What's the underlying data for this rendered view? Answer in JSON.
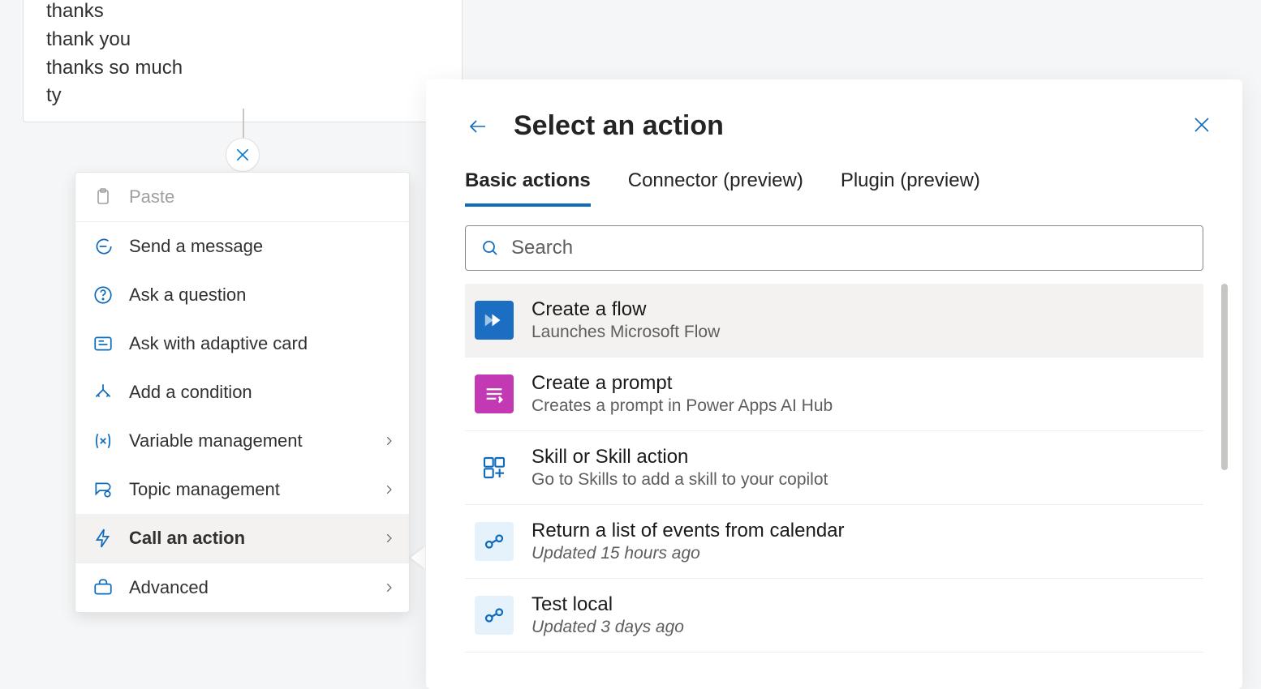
{
  "trigger": {
    "phrases": [
      "thanks",
      "thank you",
      "thanks so much",
      "ty"
    ]
  },
  "context_menu": {
    "paste": "Paste",
    "items": [
      {
        "key": "send-message",
        "label": "Send a message",
        "chev": false
      },
      {
        "key": "ask-question",
        "label": "Ask a question",
        "chev": false
      },
      {
        "key": "adaptive-card",
        "label": "Ask with adaptive card",
        "chev": false
      },
      {
        "key": "add-condition",
        "label": "Add a condition",
        "chev": false
      },
      {
        "key": "variable-mgmt",
        "label": "Variable management",
        "chev": true
      },
      {
        "key": "topic-mgmt",
        "label": "Topic management",
        "chev": true
      },
      {
        "key": "call-action",
        "label": "Call an action",
        "chev": true,
        "selected": true
      },
      {
        "key": "advanced",
        "label": "Advanced",
        "chev": true
      }
    ]
  },
  "panel": {
    "title": "Select an action",
    "tabs": [
      {
        "key": "basic",
        "label": "Basic actions",
        "active": true
      },
      {
        "key": "connector",
        "label": "Connector (preview)",
        "active": false
      },
      {
        "key": "plugin",
        "label": "Plugin (preview)",
        "active": false
      }
    ],
    "search_placeholder": "Search",
    "actions": [
      {
        "key": "create-flow",
        "title": "Create a flow",
        "subtitle": "Launches Microsoft Flow",
        "icon": "flow",
        "highlight": true
      },
      {
        "key": "create-prompt",
        "title": "Create a prompt",
        "subtitle": "Creates a prompt in Power Apps AI Hub",
        "icon": "prompt"
      },
      {
        "key": "skill",
        "title": "Skill or Skill action",
        "subtitle": "Go to Skills to add a skill to your copilot",
        "icon": "skill"
      },
      {
        "key": "calendar-flow",
        "title": "Return a list of events from calendar",
        "subtitle": "Updated 15 hours ago",
        "icon": "cloud",
        "italic": true
      },
      {
        "key": "test-local",
        "title": "Test local",
        "subtitle": "Updated 3 days ago",
        "icon": "cloud",
        "italic": true
      }
    ]
  }
}
